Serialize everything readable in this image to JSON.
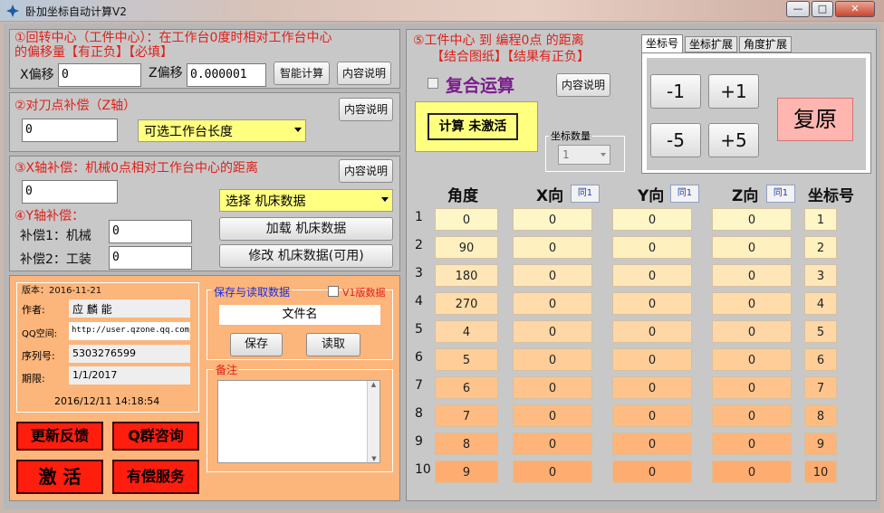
{
  "window": {
    "title": "卧加坐标自动计算V2",
    "min": "—",
    "max": "□",
    "close": "✕"
  },
  "sec1": {
    "title_line1": "①回转中心（工件中心）：在工作台0度时相对工作台中心",
    "title_line2": "的偏移量【有正负】【必填】",
    "x_label": "X偏移",
    "x_value": "0",
    "z_label": "Z偏移",
    "z_value": "0.000001",
    "smart_calc": "智能计算",
    "help": "内容说明"
  },
  "sec2": {
    "title": "②对刀点补偿（Z轴）",
    "value": "0",
    "select": "可选工作台长度",
    "help": "内容说明"
  },
  "sec3": {
    "title": "③X轴补偿：机械0点相对工作台中心的距离",
    "value": "0",
    "help": "内容说明",
    "machine_select": "选择 机床数据",
    "y_title": "④Y轴补偿：",
    "comp1_label": "补偿1：机械",
    "comp1_value": "0",
    "comp2_label": "补偿2：工装",
    "comp2_value": "0",
    "load_btn": "加载 机床数据",
    "modify_btn": "修改 机床数据(可用)"
  },
  "info": {
    "version": "版本：2016-11-21",
    "author_label": "作者:",
    "author": "应 麟 能",
    "qq_label": "QQ空间:",
    "qq": "http://user.qzone.qq.com/",
    "serial_label": "序列号:",
    "serial": "5303276599",
    "expiry_label": "期限:",
    "expiry": "1/1/2017",
    "datetime": "2016/12/11 14:18:54"
  },
  "save": {
    "title": "保存与读取数据",
    "v1_label": "V1版数据",
    "filename": "文件名",
    "save_btn": "保存",
    "read_btn": "读取",
    "note_title": "备注"
  },
  "red_buttons": {
    "feedback": "更新反馈",
    "qq_group": "Q群咨询",
    "activate": "激 活",
    "paid": "有偿服务"
  },
  "sec5": {
    "title_line1": "⑤工件中心 到 编程0点 的距离",
    "title_line2": "【结合图纸】【结果有正负】",
    "compound": "复合运算",
    "help": "内容说明",
    "calc_btn": "计算 未激活",
    "coord_count_label": "坐标数量",
    "coord_count": "1"
  },
  "tabs": [
    "坐标号",
    "坐标扩展",
    "角度扩展"
  ],
  "adjust": {
    "m1": "-1",
    "p1": "+1",
    "m5": "-5",
    "p5": "+5",
    "reset": "复原"
  },
  "table": {
    "headers": {
      "angle": "角度",
      "x": "X向",
      "y": "Y向",
      "z": "Z向",
      "coord": "坐标号"
    },
    "same_btn": "同1",
    "rows": [
      {
        "n": "1",
        "angle": "0",
        "x": "0",
        "y": "0",
        "z": "0",
        "coord": "1"
      },
      {
        "n": "2",
        "angle": "90",
        "x": "0",
        "y": "0",
        "z": "0",
        "coord": "2"
      },
      {
        "n": "3",
        "angle": "180",
        "x": "0",
        "y": "0",
        "z": "0",
        "coord": "3"
      },
      {
        "n": "4",
        "angle": "270",
        "x": "0",
        "y": "0",
        "z": "0",
        "coord": "4"
      },
      {
        "n": "5",
        "angle": "4",
        "x": "0",
        "y": "0",
        "z": "0",
        "coord": "5"
      },
      {
        "n": "6",
        "angle": "5",
        "x": "0",
        "y": "0",
        "z": "0",
        "coord": "6"
      },
      {
        "n": "7",
        "angle": "6",
        "x": "0",
        "y": "0",
        "z": "0",
        "coord": "7"
      },
      {
        "n": "8",
        "angle": "7",
        "x": "0",
        "y": "0",
        "z": "0",
        "coord": "8"
      },
      {
        "n": "9",
        "angle": "8",
        "x": "0",
        "y": "0",
        "z": "0",
        "coord": "9"
      },
      {
        "n": "10",
        "angle": "9",
        "x": "0",
        "y": "0",
        "z": "0",
        "coord": "10"
      }
    ]
  }
}
